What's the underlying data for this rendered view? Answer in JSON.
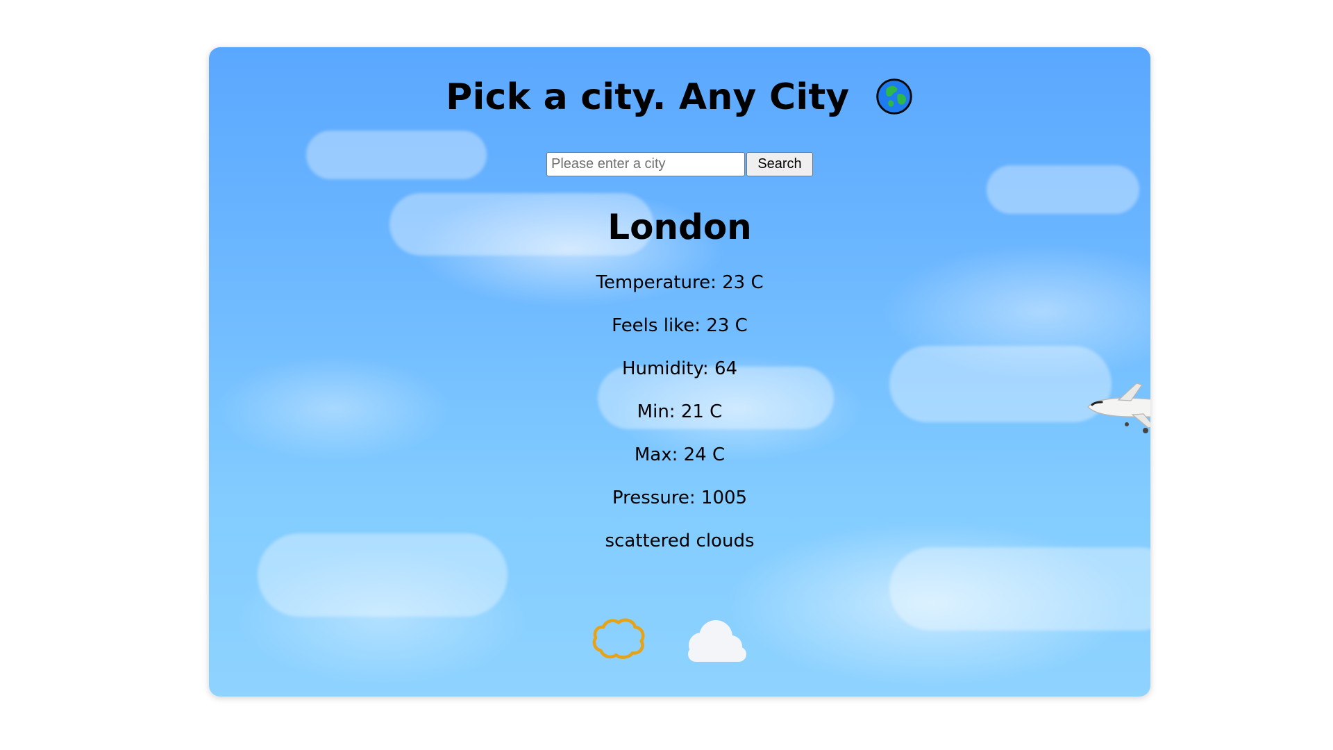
{
  "header": {
    "title": "Pick a city. Any City",
    "title_icon": "globe-icon"
  },
  "search": {
    "placeholder": "Please enter a city",
    "value": "",
    "button_label": "Search"
  },
  "weather": {
    "city": "London",
    "temperature": "Temperature: 23 C",
    "feels_like": "Feels like: 23 C",
    "humidity": "Humidity: 64",
    "min": "Min: 21 C",
    "max": "Max: 24 C",
    "pressure": "Pressure: 1005",
    "description": "scattered clouds"
  },
  "icons": {
    "weather_icon_1": "cloud-outline-icon",
    "weather_icon_2": "cloud-icon",
    "decoration": "airplane-icon"
  },
  "colors": {
    "sky_top": "#5aa7ff",
    "sky_bottom": "#8fd3ff",
    "cloud_outline": "#e6a317",
    "text": "#000000"
  }
}
